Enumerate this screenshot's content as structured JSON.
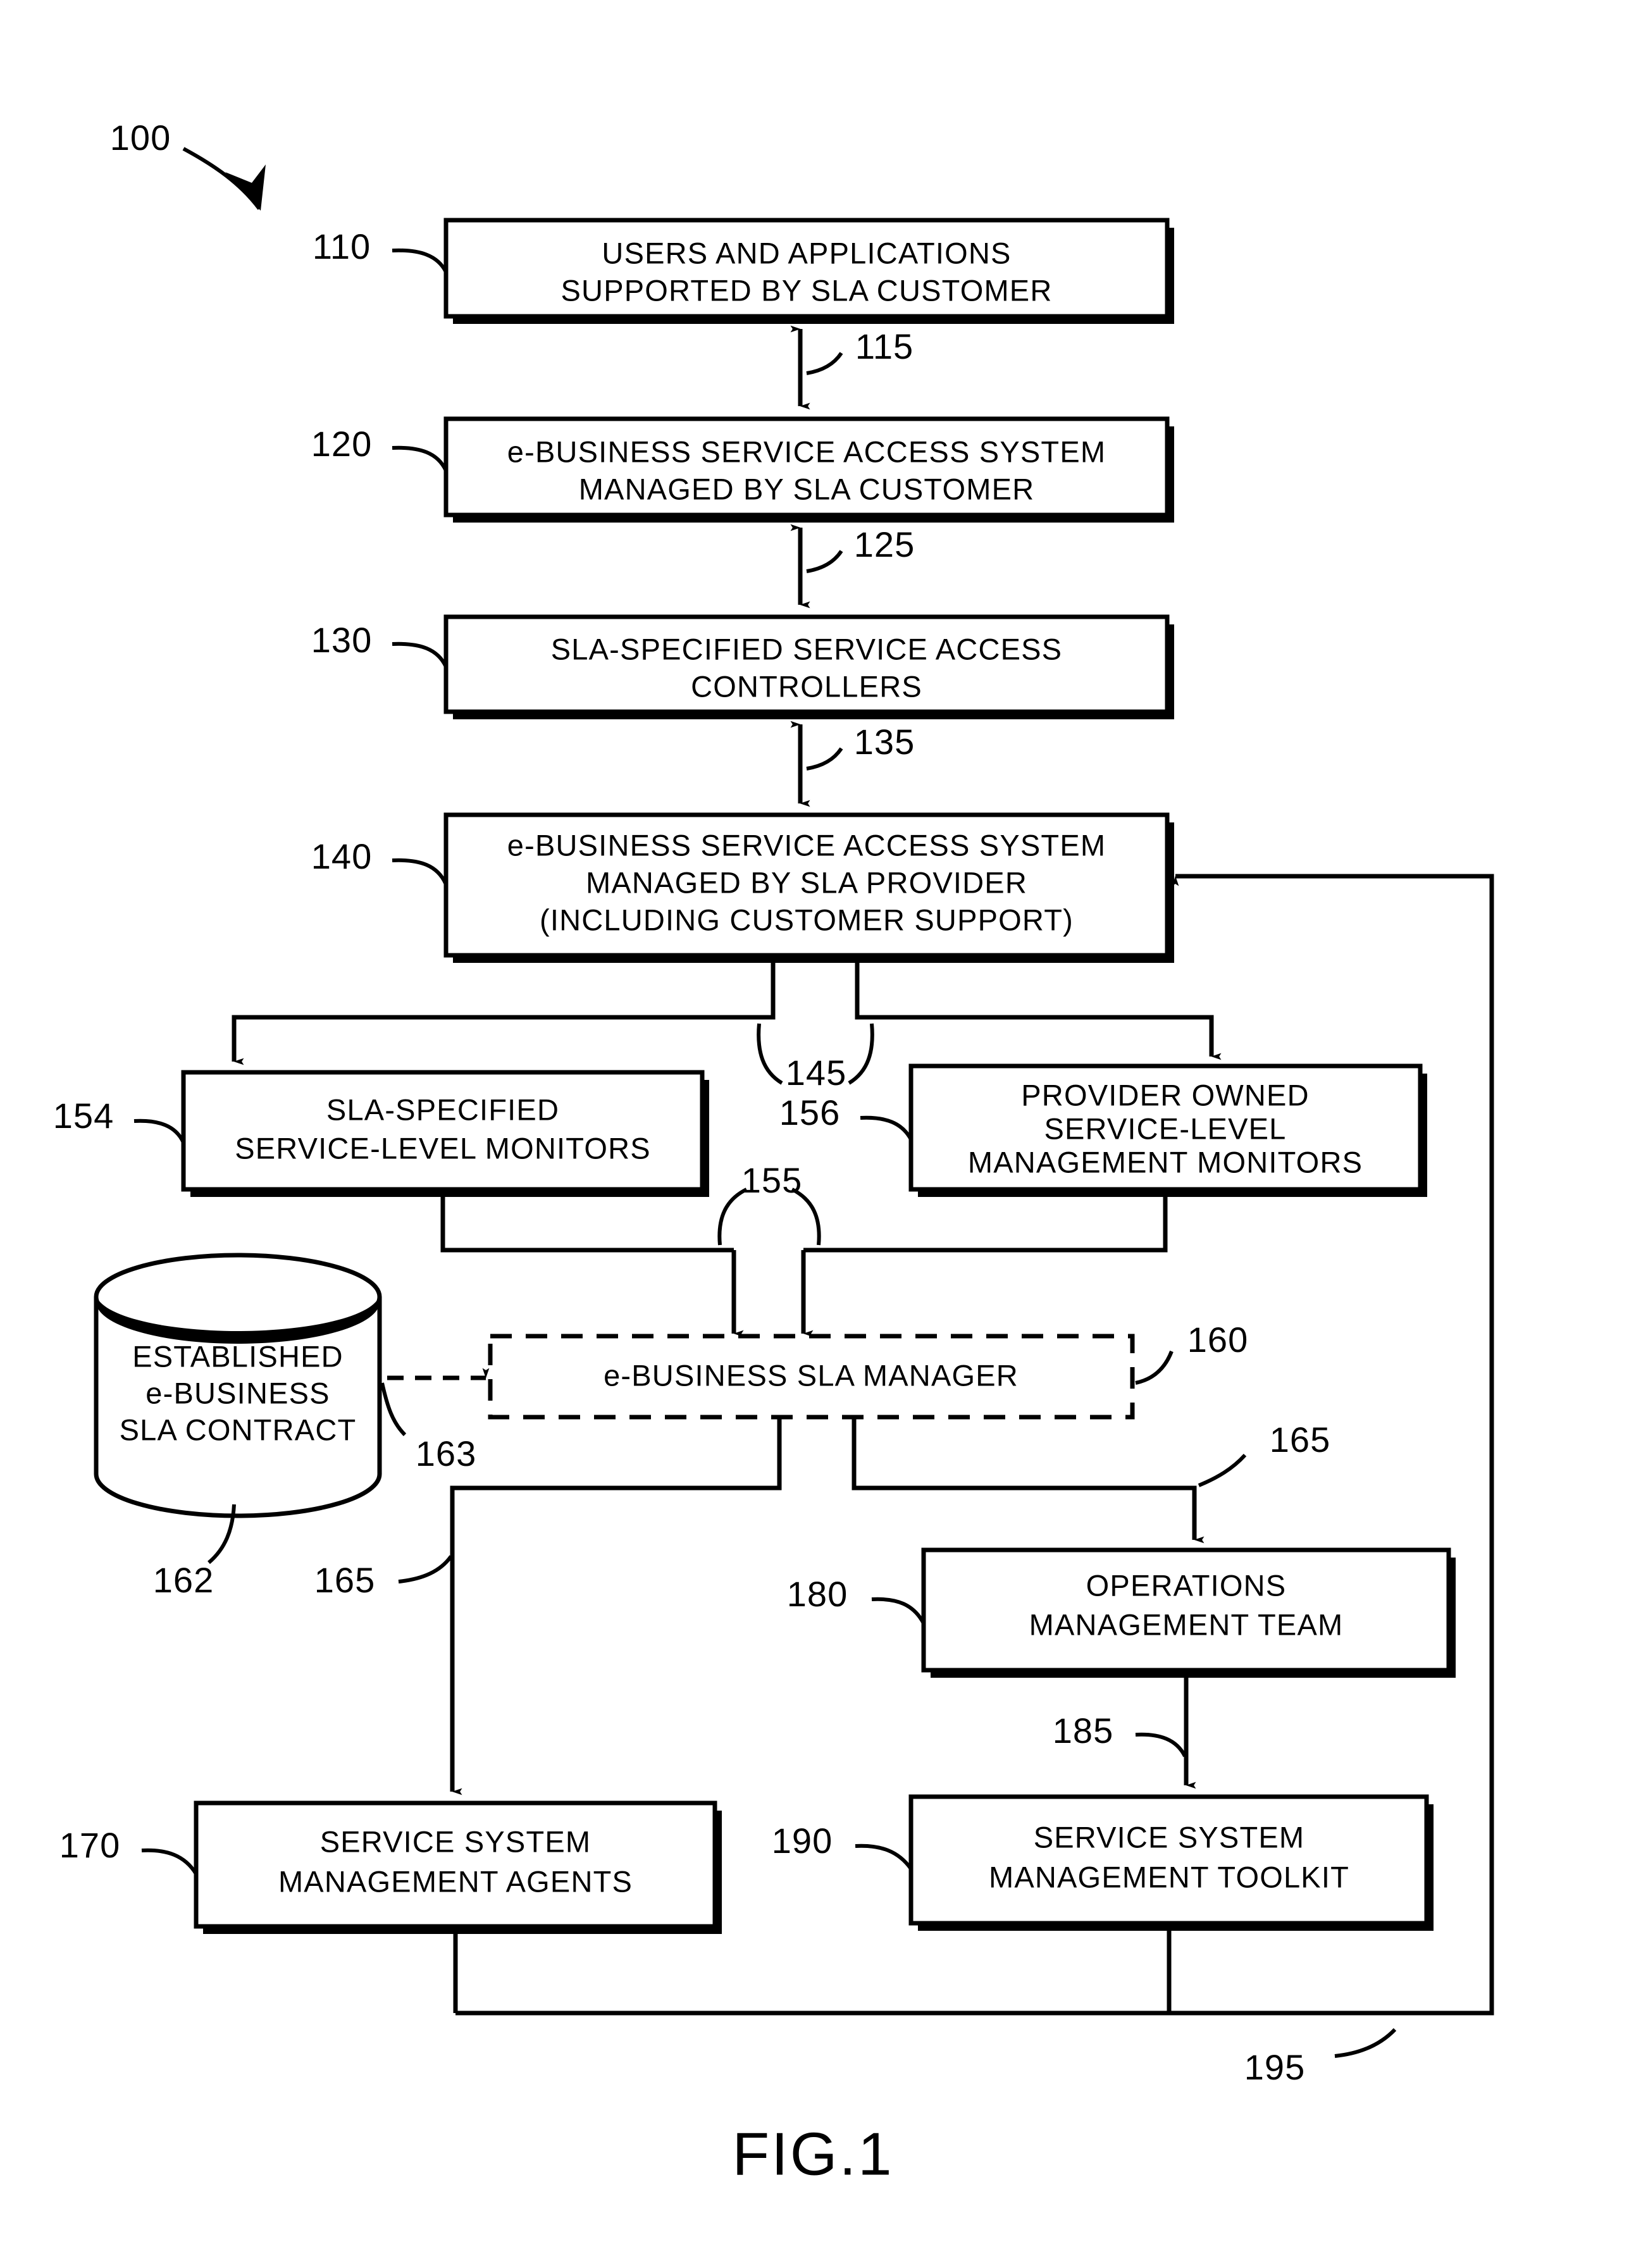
{
  "figure": {
    "caption": "FIG.1",
    "system_ref": "100"
  },
  "nodes": [
    {
      "ref": "110",
      "name": "users-and-applications",
      "shape": "box",
      "lines": [
        "USERS AND APPLICATIONS",
        "SUPPORTED BY SLA CUSTOMER"
      ]
    },
    {
      "ref": "120",
      "name": "customer-service-access-system",
      "shape": "box",
      "lines": [
        "e-BUSINESS SERVICE ACCESS SYSTEM",
        "MANAGED BY SLA CUSTOMER"
      ]
    },
    {
      "ref": "130",
      "name": "sla-specified-service-access-controllers",
      "shape": "box",
      "lines": [
        "SLA-SPECIFIED SERVICE ACCESS",
        "CONTROLLERS"
      ]
    },
    {
      "ref": "140",
      "name": "provider-service-access-system",
      "shape": "box",
      "lines": [
        "e-BUSINESS SERVICE ACCESS SYSTEM",
        "MANAGED BY SLA PROVIDER",
        "(INCLUDING CUSTOMER SUPPORT)"
      ]
    },
    {
      "ref": "154",
      "name": "sla-specified-service-level-monitors",
      "shape": "box",
      "lines": [
        "SLA-SPECIFIED",
        "SERVICE-LEVEL MONITORS"
      ]
    },
    {
      "ref": "156",
      "name": "provider-owned-service-level-management-monitors",
      "shape": "box",
      "lines": [
        "PROVIDER OWNED",
        "SERVICE-LEVEL",
        "MANAGEMENT MONITORS"
      ]
    },
    {
      "ref": "162",
      "name": "established-sla-contract-store",
      "shape": "cylinder",
      "lines": [
        "ESTABLISHED",
        "e-BUSINESS",
        "SLA  CONTRACT"
      ]
    },
    {
      "ref": "160",
      "name": "e-business-sla-manager",
      "shape": "dashed-box",
      "lines": [
        "e-BUSINESS SLA MANAGER"
      ]
    },
    {
      "ref": "180",
      "name": "operations-management-team",
      "shape": "box",
      "lines": [
        "OPERATIONS",
        "MANAGEMENT TEAM"
      ]
    },
    {
      "ref": "170",
      "name": "service-system-management-agents",
      "shape": "box",
      "lines": [
        "SERVICE SYSTEM",
        "MANAGEMENT AGENTS"
      ]
    },
    {
      "ref": "190",
      "name": "service-system-management-toolkit",
      "shape": "box",
      "lines": [
        "SERVICE SYSTEM",
        "MANAGEMENT TOOLKIT"
      ]
    }
  ],
  "connector_refs": {
    "c115": "115",
    "c125": "125",
    "c135": "135",
    "c145": "145",
    "c155": "155",
    "c163": "163",
    "c165a": "165",
    "c165b": "165",
    "c185": "185",
    "c195": "195"
  }
}
